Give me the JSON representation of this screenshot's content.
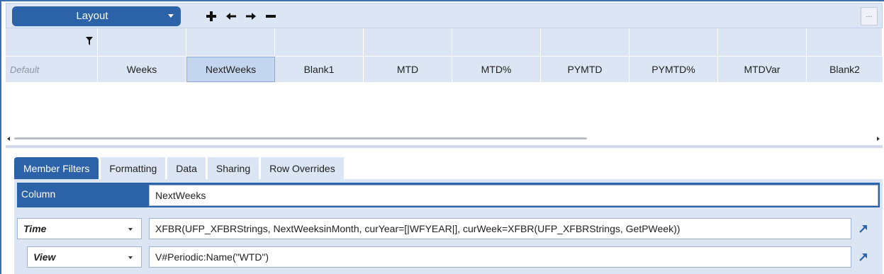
{
  "toolbar": {
    "layout_label": "Layout",
    "add_icon": "plus-icon",
    "left_icon": "arrow-left-icon",
    "right_icon": "arrow-right-icon",
    "remove_icon": "minus-icon",
    "more_label": "..."
  },
  "grid": {
    "row_label": "Default",
    "columns": [
      "Weeks",
      "NextWeeks",
      "Blank1",
      "MTD",
      "MTD%",
      "PYMTD",
      "PYMTD%",
      "MTDVar",
      "Blank2"
    ],
    "selected_column": "NextWeeks"
  },
  "tabs": [
    "Member Filters",
    "Formatting",
    "Data",
    "Sharing",
    "Row Overrides"
  ],
  "active_tab": "Member Filters",
  "member_filters": {
    "column_label": "Column",
    "column_value": "NextWeeks",
    "rows": [
      {
        "dimension": "Time",
        "expression": "XFBR(UFP_XFBRStrings, NextWeeksinMonth, curYear=[|WFYEAR|], curWeek=XFBR(UFP_XFBRStrings, GetPWeek))"
      },
      {
        "dimension": "View",
        "expression": "V#Periodic:Name(\"WTD\")"
      }
    ]
  },
  "colors": {
    "accent": "#2b62a8",
    "panel": "#dbe5f4",
    "selected_cell": "#c4d5ef"
  }
}
